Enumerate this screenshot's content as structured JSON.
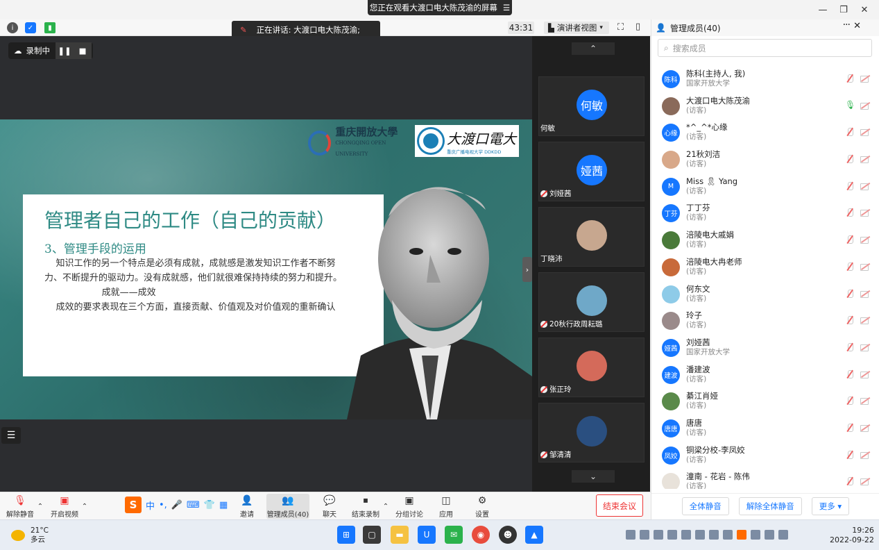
{
  "window": {
    "share_banner": "您正在观看大渡口电大陈茂渝的屏幕",
    "controls": [
      "minimize",
      "maximize",
      "close"
    ]
  },
  "topbar": {
    "speaking": "正在讲话: 大渡口电大陈茂渝;",
    "timer": "43:31",
    "view_mode": "演讲者视图"
  },
  "recording": {
    "label": "录制中"
  },
  "slide": {
    "title": "管理者自己的工作（自己的贡献）",
    "subtitle": "3、管理手段的运用",
    "body": [
      "    知识工作的另一个特点是必须有成就，成就感是激发知识工作者不断努力、不断提升的驱动力。没有成就感，他们就很难保持持续的努力和提升。",
      "                    成就——成效",
      "    成效的要求表现在三个方面，直接贡献、价值观及对价值观的重新确认"
    ],
    "logo_left": "重庆開放大學",
    "logo_left_en": "CHONGQING OPEN UNIVERSITY",
    "logo_right": "大渡口電大",
    "logo_right_sub": "重庆广播电视大学 DDKDD"
  },
  "video_tiles": [
    {
      "avatar": "何敏",
      "name": "何敏",
      "muted": false
    },
    {
      "avatar": "娅茜",
      "name": "刘娅茜",
      "muted": true
    },
    {
      "avatar": "",
      "name": "丁晓沛",
      "muted": false
    },
    {
      "avatar": "",
      "name": "20秋行政周耘璐",
      "muted": true
    },
    {
      "avatar": "",
      "name": "张正玲",
      "muted": true
    },
    {
      "avatar": "",
      "name": "邹清清",
      "muted": true
    }
  ],
  "members_panel": {
    "title": "管理成员(40)",
    "search_placeholder": "搜索成员",
    "members": [
      {
        "avatar": "陈科",
        "name": "陈科(主持人, 我)",
        "sub": "国家开放大学"
      },
      {
        "avatar": "",
        "name": "大渡口电大陈茂渝",
        "sub": "(访客)"
      },
      {
        "avatar": "心缘",
        "name": "*^_^*心缘",
        "sub": "(访客)"
      },
      {
        "avatar": "",
        "name": "21秋刘洁",
        "sub": "(访客)"
      },
      {
        "avatar": "M",
        "name": "Miss 🎗 Yang",
        "sub": "(访客)"
      },
      {
        "avatar": "丁芬",
        "name": "丁丁芬",
        "sub": "(访客)"
      },
      {
        "avatar": "",
        "name": "涪陵电大戚娟",
        "sub": "(访客)"
      },
      {
        "avatar": "",
        "name": "涪陵电大冉老师",
        "sub": "(访客)"
      },
      {
        "avatar": "",
        "name": "何东文",
        "sub": "(访客)"
      },
      {
        "avatar": "",
        "name": "玲子",
        "sub": "(访客)"
      },
      {
        "avatar": "娅茜",
        "name": "刘娅茜",
        "sub": "国家开放大学"
      },
      {
        "avatar": "建波",
        "name": "潘建波",
        "sub": "(访客)"
      },
      {
        "avatar": "",
        "name": "綦江肖娅",
        "sub": "(访客)"
      },
      {
        "avatar": "唐唐",
        "name": "唐唐",
        "sub": "(访客)"
      },
      {
        "avatar": "凤姣",
        "name": "铜梁分校-李凤姣",
        "sub": "(访客)"
      },
      {
        "avatar": "",
        "name": "潼南 - 花岩 - 陈伟",
        "sub": "(访客)"
      }
    ],
    "footer": {
      "mute_all": "全体静音",
      "unmute_all": "解除全体静音",
      "more": "更多 ▾"
    }
  },
  "bottombar": {
    "unmute": "解除静音",
    "start_video": "开启视频",
    "invite": "邀请",
    "members": "管理成员(40)",
    "chat": "聊天",
    "end_recording": "结束录制",
    "breakout": "分组讨论",
    "apps": "应用",
    "settings": "设置",
    "end_meeting": "结束会议"
  },
  "ime": {
    "mode": "中"
  },
  "taskbar": {
    "temperature": "21°C",
    "weather": "多云",
    "time": "19:26",
    "date": "2022-09-22"
  }
}
